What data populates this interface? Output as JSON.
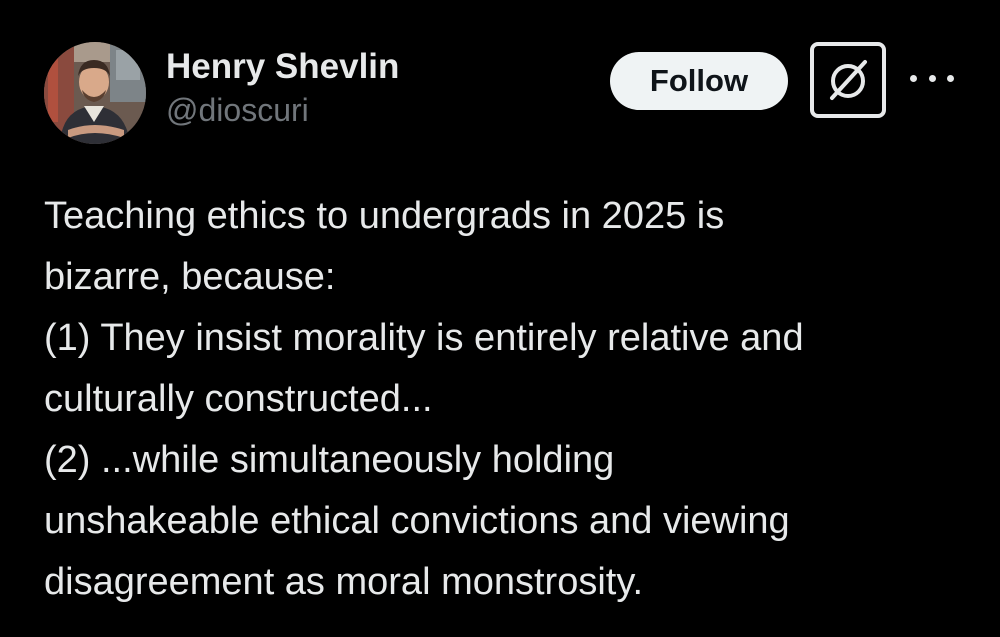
{
  "author": {
    "display_name": "Henry Shevlin",
    "handle": "@dioscuri",
    "avatar_icon": "profile-photo"
  },
  "actions": {
    "follow_label": "Follow",
    "grok_icon": "grok-icon",
    "more_icon": "more-options-icon"
  },
  "tweet": {
    "lines": [
      "Teaching ethics to undergrads in 2025 is",
      "bizarre, because:",
      "(1) They insist morality is entirely relative and",
      "culturally constructed...",
      "(2) ...while simultaneously holding",
      "unshakeable ethical convictions and viewing",
      "disagreement as moral monstrosity."
    ]
  },
  "colors": {
    "background": "#000000",
    "text_primary": "#e7e9ea",
    "text_secondary": "#71767b",
    "follow_bg": "#eff3f4"
  }
}
